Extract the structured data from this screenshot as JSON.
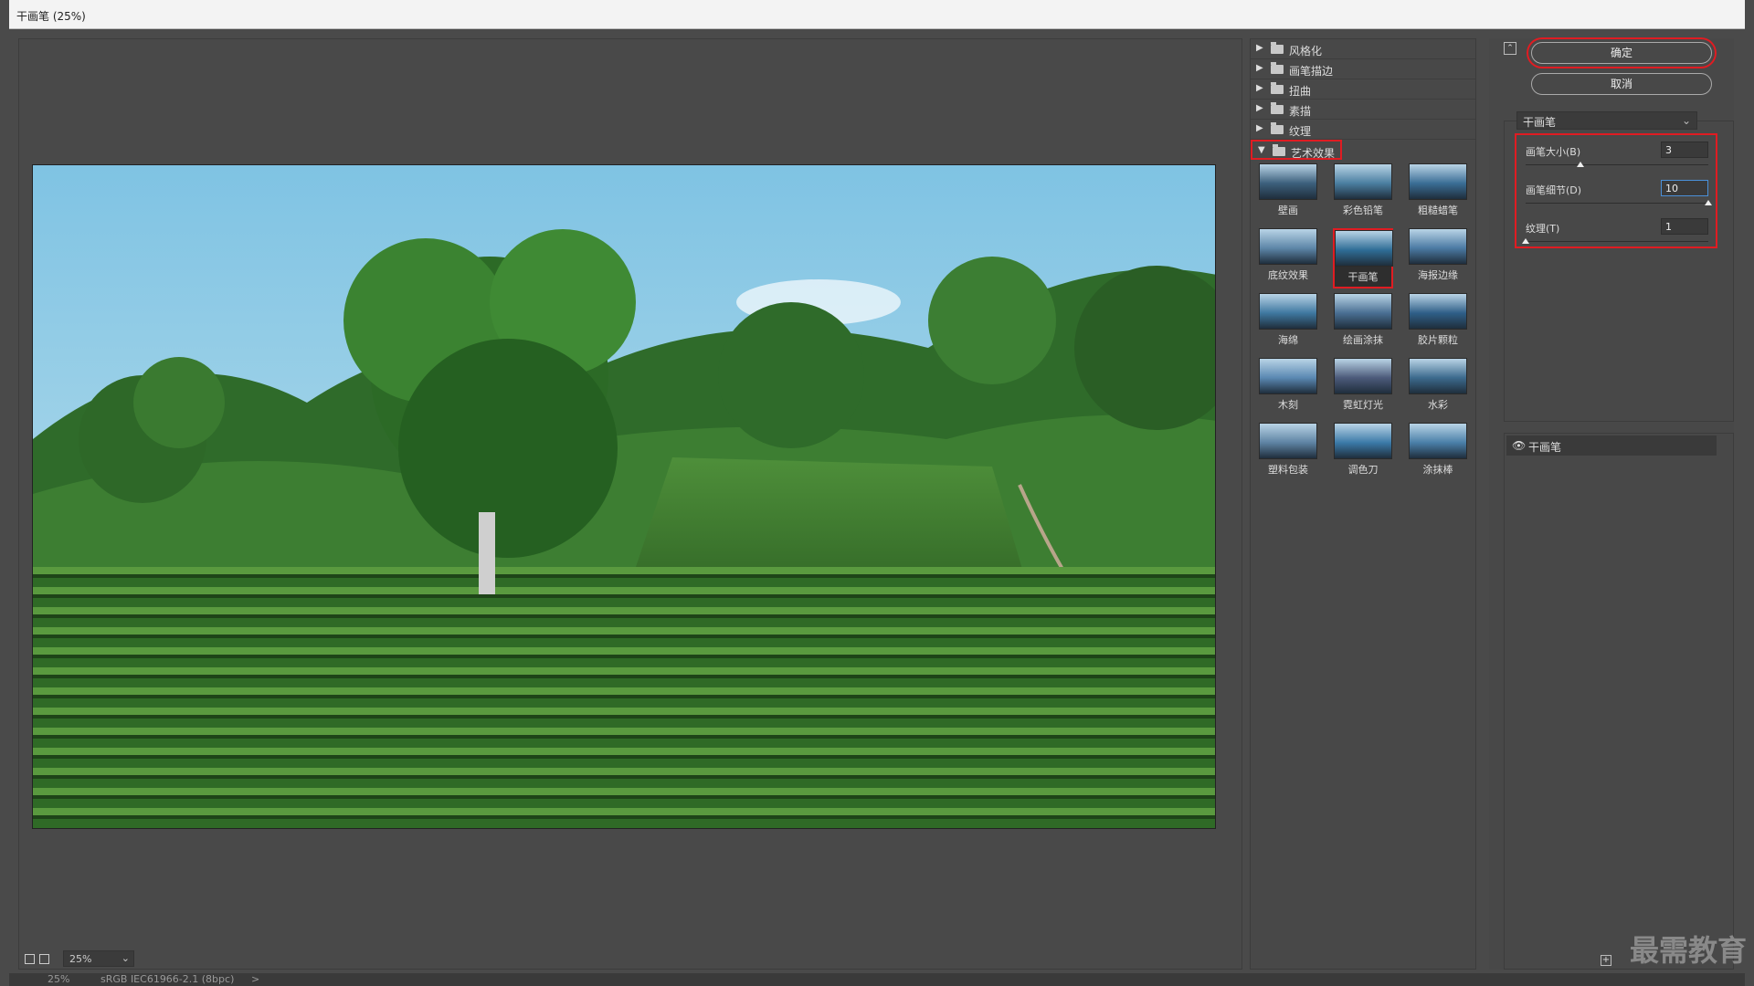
{
  "window": {
    "title": "干画笔 (25%)"
  },
  "zoom": {
    "value": "25%",
    "caret": "⌄"
  },
  "status": {
    "zoom": "25%",
    "profile": "sRGB IEC61966-2.1 (8bpc)",
    "arrow": ">"
  },
  "categories": [
    {
      "label": "风格化",
      "arrow": "▶"
    },
    {
      "label": "画笔描边",
      "arrow": "▶"
    },
    {
      "label": "扭曲",
      "arrow": "▶"
    },
    {
      "label": "素描",
      "arrow": "▶"
    },
    {
      "label": "纹理",
      "arrow": "▶"
    },
    {
      "label": "艺术效果",
      "arrow": "▼"
    }
  ],
  "thumbnails": [
    {
      "label": "壁画",
      "selected": false
    },
    {
      "label": "彩色铅笔",
      "selected": false
    },
    {
      "label": "粗糙蜡笔",
      "selected": false
    },
    {
      "label": "底纹效果",
      "selected": false
    },
    {
      "label": "干画笔",
      "selected": true
    },
    {
      "label": "海报边缘",
      "selected": false
    },
    {
      "label": "海绵",
      "selected": false
    },
    {
      "label": "绘画涂抹",
      "selected": false
    },
    {
      "label": "胶片颗粒",
      "selected": false
    },
    {
      "label": "木刻",
      "selected": false
    },
    {
      "label": "霓虹灯光",
      "selected": false
    },
    {
      "label": "水彩",
      "selected": false
    },
    {
      "label": "塑料包装",
      "selected": false
    },
    {
      "label": "调色刀",
      "selected": false
    },
    {
      "label": "涂抹棒",
      "selected": false
    }
  ],
  "settings": {
    "ok_label": "确定",
    "cancel_label": "取消",
    "filter_select": "干画笔",
    "select_caret": "⌄",
    "collapse_icon": "⌃",
    "params": [
      {
        "label": "画笔大小(B)",
        "value": "3",
        "level": 0.3
      },
      {
        "label": "画笔细节(D)",
        "value": "10",
        "level": 1.0
      },
      {
        "label": "纹理(T)",
        "value": "1",
        "level": 0.0
      }
    ]
  },
  "layers": {
    "eye_icon": "👁",
    "name": "干画笔",
    "new_icon": "+"
  },
  "watermark": "最需教育",
  "colors": {
    "accent_red": "#e01c22",
    "focus_blue": "#4a90d9"
  }
}
